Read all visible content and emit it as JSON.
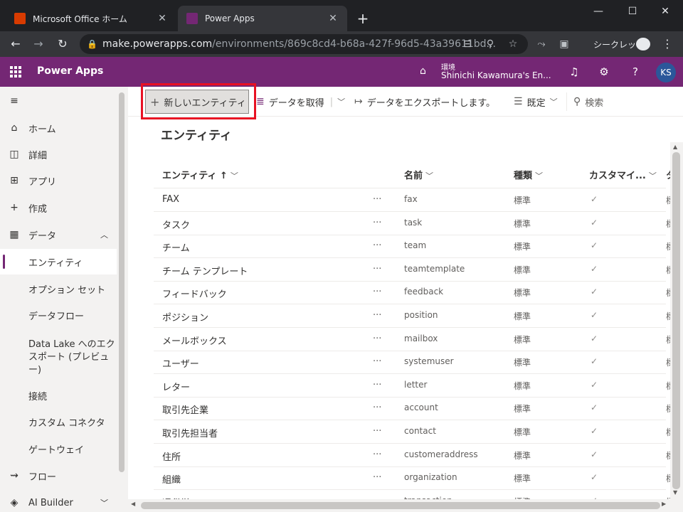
{
  "browser": {
    "tabs": [
      {
        "title": "Microsoft Office ホーム",
        "favicon_color": "#d83b01",
        "close": "✕"
      },
      {
        "title": "Power Apps",
        "favicon_color": "#742774",
        "close": "✕"
      }
    ],
    "new_tab": "+",
    "window_controls": {
      "minimize": "—",
      "maximize": "☐",
      "close": "✕"
    },
    "url_host": "make.powerapps.com",
    "url_path": "/environments/869c8cd4-b68a-427f-96d5-43a39611bd...",
    "incognito_label": "シークレット",
    "nav": {
      "back": "←",
      "forward": "→",
      "reload": "↻"
    }
  },
  "app": {
    "name": "Power Apps",
    "environment_label": "環境",
    "environment_name": "Shinichi Kawamura's En...",
    "avatar_initials": "KS",
    "header_icons": {
      "bell": "🔔",
      "settings": "⚙",
      "help": "?"
    }
  },
  "sidebar": {
    "hamburger": "≡",
    "items": [
      {
        "label": "ホーム",
        "icon": "⌂"
      },
      {
        "label": "詳細",
        "icon": "◫"
      },
      {
        "label": "アプリ",
        "icon": "⊞"
      },
      {
        "label": "作成",
        "icon": "+"
      },
      {
        "label": "データ",
        "icon": "▦",
        "chevron": "︿"
      },
      {
        "label": "エンティティ"
      },
      {
        "label": "オプション セット"
      },
      {
        "label": "データフロー"
      },
      {
        "label": "Data Lake へのエクスポート (プレビュー)"
      },
      {
        "label": "接続"
      },
      {
        "label": "カスタム コネクタ"
      },
      {
        "label": "ゲートウェイ"
      },
      {
        "label": "フロー",
        "icon": "⇝"
      },
      {
        "label": "AI Builder",
        "icon": "◈",
        "chevron": "﹀"
      }
    ]
  },
  "commandbar": {
    "new_entity": "新しいエンティティ",
    "get_data": "データを取得",
    "export_data": "データをエクスポートします。",
    "view_default": "既定",
    "search": "検索"
  },
  "main": {
    "title": "エンティティ",
    "columns": {
      "entity": "エンティティ ↑",
      "name": "名前",
      "type": "種類",
      "customizable": "カスタマイ...",
      "extra": "タ"
    },
    "rows": [
      {
        "entity": "FAX",
        "name": "fax",
        "type": "標準",
        "custom": "✓",
        "extra": "標"
      },
      {
        "entity": "タスク",
        "name": "task",
        "type": "標準",
        "custom": "✓",
        "extra": "標"
      },
      {
        "entity": "チーム",
        "name": "team",
        "type": "標準",
        "custom": "✓",
        "extra": "標"
      },
      {
        "entity": "チーム テンプレート",
        "name": "teamtemplate",
        "type": "標準",
        "custom": "✓",
        "extra": "標"
      },
      {
        "entity": "フィードバック",
        "name": "feedback",
        "type": "標準",
        "custom": "✓",
        "extra": "標"
      },
      {
        "entity": "ポジション",
        "name": "position",
        "type": "標準",
        "custom": "✓",
        "extra": "標"
      },
      {
        "entity": "メールボックス",
        "name": "mailbox",
        "type": "標準",
        "custom": "✓",
        "extra": "標"
      },
      {
        "entity": "ユーザー",
        "name": "systemuser",
        "type": "標準",
        "custom": "✓",
        "extra": "標"
      },
      {
        "entity": "レター",
        "name": "letter",
        "type": "標準",
        "custom": "✓",
        "extra": "標"
      },
      {
        "entity": "取引先企業",
        "name": "account",
        "type": "標準",
        "custom": "✓",
        "extra": "標"
      },
      {
        "entity": "取引先担当者",
        "name": "contact",
        "type": "標準",
        "custom": "✓",
        "extra": "標"
      },
      {
        "entity": "住所",
        "name": "customeraddress",
        "type": "標準",
        "custom": "✓",
        "extra": "標"
      },
      {
        "entity": "組織",
        "name": "organization",
        "type": "標準",
        "custom": "✓",
        "extra": "標"
      },
      {
        "entity": "通貨単",
        "name": "transaction...",
        "type": "標準",
        "custom": "✓",
        "extra": "標"
      }
    ],
    "more": "···"
  }
}
